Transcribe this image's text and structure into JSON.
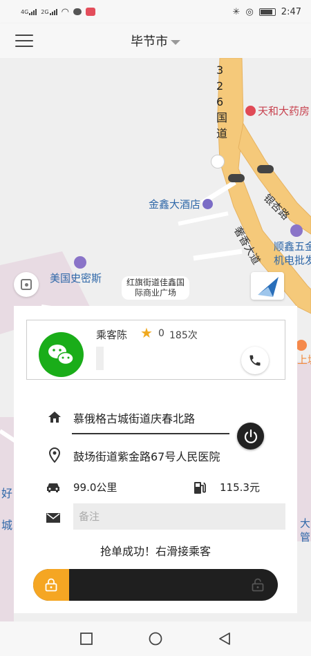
{
  "status_bar": {
    "network_1": "4G",
    "network_2": "2G",
    "time": "2:47"
  },
  "header": {
    "city": "毕节市"
  },
  "map": {
    "labels": {
      "road_326": "3 2 6 国 道",
      "pharmacy": "天和大药房",
      "hotel": "金鑫大酒店",
      "road_yinxing": "银杏路",
      "road_xiangxiang": "奢香大道",
      "shunxin_line1": "顺鑫五金",
      "shunxin_line2": "机电批发",
      "meiguo": "美国史密斯",
      "hongqi_line1": "红旗街道佳鑫国",
      "hongqi_line2": "际商业广场",
      "left_1": "好",
      "left_2": "城",
      "right_1": "上城",
      "right_2": "大",
      "right_3": "管"
    }
  },
  "passenger": {
    "name": "乘客陈",
    "rating": "0",
    "order_count": "185次"
  },
  "order": {
    "from": "慕俄格古城街道庆春北路",
    "to": "鼓场街道紫金路67号人民医院",
    "distance": "99.0公里",
    "price": "115.3元",
    "remark_placeholder": "备注",
    "success_message": "抢单成功！右滑接乘客"
  },
  "colors": {
    "accent": "#f5a623",
    "wechat": "#1aad19",
    "road": "#f5c97a"
  }
}
